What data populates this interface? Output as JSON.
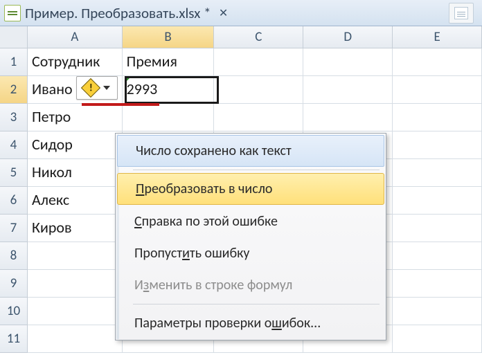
{
  "window": {
    "title": "Пример. Преобразовать.xlsx *"
  },
  "columns": {
    "A": "A",
    "B": "B",
    "C": "C",
    "D": "D",
    "E": "E"
  },
  "rows": [
    "1",
    "2",
    "3",
    "4",
    "5",
    "6",
    "7",
    "8",
    "9",
    "10",
    "11"
  ],
  "cells": {
    "A1": "Сотрудник",
    "B1": "Премия",
    "A2": "Ивано",
    "B2": "2993",
    "A3": "Петро",
    "A4": "Сидор",
    "A5": "Никол",
    "A6": "Алекс",
    "A7": "Киров"
  },
  "smarttag": {
    "glyph": "!"
  },
  "menu": {
    "header": "Число сохранено как текст",
    "convert_pre": "",
    "convert_ul": "П",
    "convert_post": "реобразовать в число",
    "help_pre": "",
    "help_ul": "С",
    "help_post": "правка по этой ошибке",
    "ignore_pre": "Пропуст",
    "ignore_ul": "и",
    "ignore_post": "ть ошибку",
    "edit_pre": "И",
    "edit_ul": "з",
    "edit_post": "менить в строке формул",
    "params_pre": "Параметры проверки о",
    "params_ul": "ш",
    "params_post": "ибок..."
  }
}
